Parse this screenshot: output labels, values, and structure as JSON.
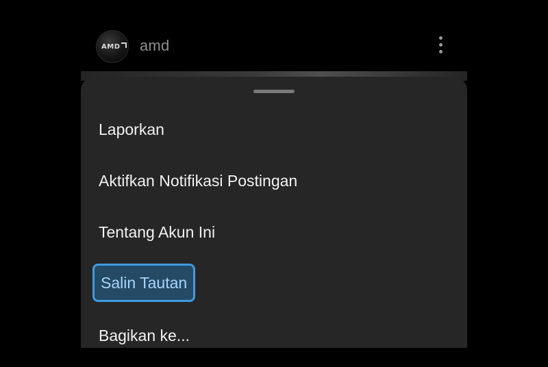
{
  "post": {
    "avatar_label": "AMD",
    "username": "amd",
    "more_icon": "more-vertical-icon"
  },
  "sheet": {
    "items": [
      {
        "label": "Laporkan"
      },
      {
        "label": "Aktifkan Notifikasi Postingan"
      },
      {
        "label": "Tentang Akun Ini"
      },
      {
        "label": "Salin Tautan",
        "highlighted": true
      },
      {
        "label": "Bagikan ke..."
      }
    ]
  },
  "colors": {
    "background": "#000000",
    "sheet": "#262626",
    "highlight_border": "#3f9be0",
    "highlight_fill": "#244a66",
    "highlight_text": "#a8d5f7"
  }
}
